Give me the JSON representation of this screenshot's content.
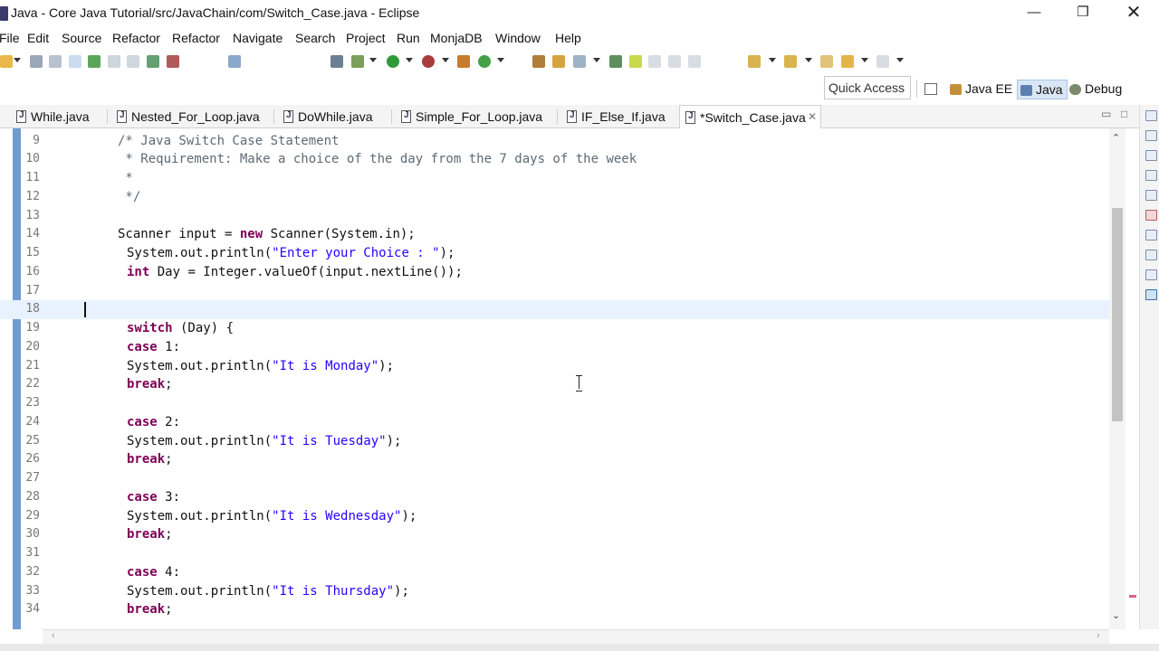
{
  "window": {
    "title": "Java - Core Java Tutorial/src/JavaChain/com/Switch_Case.java - Eclipse",
    "min_glyph": "—",
    "max_glyph": "❐",
    "close_glyph": "✕"
  },
  "menu": {
    "items": [
      "File",
      "Edit",
      "Source",
      "Refactor",
      "Refactor",
      "Navigate",
      "Search",
      "Project",
      "Run",
      "MonjaDB",
      "Window",
      "Help"
    ]
  },
  "perspectives": {
    "quick_access": "Quick Access",
    "items": [
      "Java EE",
      "Java",
      "Debug"
    ],
    "active": "Java"
  },
  "tabs": [
    {
      "label": "While.java"
    },
    {
      "label": "Nested_For_Loop.java"
    },
    {
      "label": "DoWhile.java"
    },
    {
      "label": "Simple_For_Loop.java"
    },
    {
      "label": "IF_Else_If.java"
    },
    {
      "label": "*Switch_Case.java",
      "active": true
    }
  ],
  "tab_controls": {
    "minimize": "▭",
    "maximize": "□",
    "close": "✕"
  },
  "editor": {
    "current_line": "18",
    "lines": [
      {
        "n": "9",
        "code": "/* Java Switch Case Statement"
      },
      {
        "n": "10",
        "code": " * Requirement: Make a choice of the day from the 7 days of the week"
      },
      {
        "n": "11",
        "code": " *"
      },
      {
        "n": "12",
        "code": " */"
      },
      {
        "n": "13",
        "code": ""
      },
      {
        "n": "14",
        "code": "Scanner input = new Scanner(System.in);"
      },
      {
        "n": "15",
        "code": "System.out.println(\"Enter your Choice : \");"
      },
      {
        "n": "16",
        "code": "int Day = Integer.valueOf(input.nextLine());"
      },
      {
        "n": "17",
        "code": ""
      },
      {
        "n": "18",
        "code": ""
      },
      {
        "n": "19",
        "code": "switch (Day) {"
      },
      {
        "n": "20",
        "code": "case 1:"
      },
      {
        "n": "21",
        "code": "System.out.println(\"It is Monday\");"
      },
      {
        "n": "22",
        "code": "break;"
      },
      {
        "n": "23",
        "code": ""
      },
      {
        "n": "24",
        "code": "case 2:"
      },
      {
        "n": "25",
        "code": "System.out.println(\"It is Tuesday\");"
      },
      {
        "n": "26",
        "code": "break;"
      },
      {
        "n": "27",
        "code": ""
      },
      {
        "n": "28",
        "code": "case 3:"
      },
      {
        "n": "29",
        "code": "System.out.println(\"It is Wednesday\");"
      },
      {
        "n": "30",
        "code": "break;"
      },
      {
        "n": "31",
        "code": ""
      },
      {
        "n": "32",
        "code": "case 4:"
      },
      {
        "n": "33",
        "code": "System.out.println(\"It is Thursday\");"
      },
      {
        "n": "34",
        "code": "break;"
      }
    ]
  },
  "colors": {
    "keyword": "#7f0055",
    "string": "#2a00ff",
    "comment": "#3f7f5f",
    "current_line": "#e8f2fe",
    "breakpoint_bar": "#6f9bd3"
  }
}
